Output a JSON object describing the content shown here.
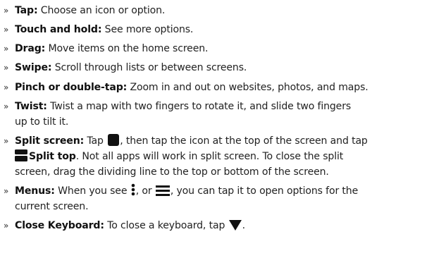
{
  "bullet": "»",
  "items": [
    {
      "term": "Tap:",
      "text": "Choose an icon or option."
    },
    {
      "term": "Touch and hold:",
      "text": "See more options."
    },
    {
      "term": "Drag:",
      "text": "Move items on the home screen."
    },
    {
      "term": "Swipe:",
      "text": "Scroll through lists or between screens."
    },
    {
      "term": "Pinch or double-tap:",
      "text": "Zoom in and out on websites, photos, and maps."
    },
    {
      "term": "Twist:",
      "line1": "Twist a map with two fingers to rotate it, and slide two fingers",
      "line2": "up to tilt it."
    },
    {
      "term": "Split screen:",
      "a": "Tap",
      "b": ", then tap the icon at the top of the screen and tap",
      "c_bold": "Split top",
      "d": ". Not all apps will work in split screen. To close the split",
      "line3": "screen, drag the dividing line to the top or bottom of the screen."
    },
    {
      "term": "Menus:",
      "a": "When you see",
      "b": ", or",
      "c": ", you can tap it to open options for the",
      "line2": "current screen."
    },
    {
      "term": "Close Keyboard:",
      "a": "To close a keyboard, tap",
      "b": "."
    }
  ],
  "icons": {
    "recents": "square-icon",
    "split": "split-screen-icon",
    "more": "vertical-dots-icon",
    "menu": "hamburger-menu-icon",
    "back": "triangle-down-icon"
  }
}
